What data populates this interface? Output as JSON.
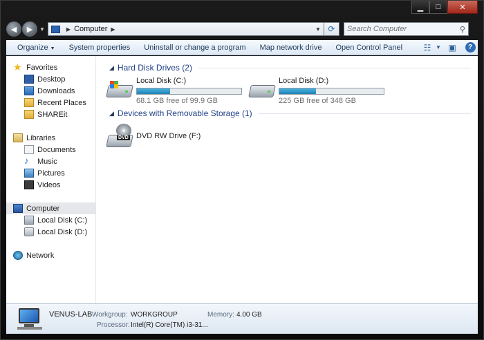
{
  "window": {
    "minimize_glyph": "▁",
    "maximize_glyph": "□",
    "close_glyph": "✕"
  },
  "address": {
    "crumb": "Computer",
    "search_placeholder": "Search Computer"
  },
  "toolbar": {
    "items": [
      {
        "label": "Organize",
        "has_caret": true
      },
      {
        "label": "System properties"
      },
      {
        "label": "Uninstall or change a program"
      },
      {
        "label": "Map network drive"
      },
      {
        "label": "Open Control Panel"
      }
    ],
    "help_glyph": "?"
  },
  "sidebar": {
    "favorites": {
      "label": "Favorites",
      "items": [
        {
          "label": "Desktop",
          "icon": "desktop-icon"
        },
        {
          "label": "Downloads",
          "icon": "downloads-icon"
        },
        {
          "label": "Recent Places",
          "icon": "recent-places-icon"
        },
        {
          "label": "SHAREit",
          "icon": "folder-icon"
        }
      ]
    },
    "libraries": {
      "label": "Libraries",
      "items": [
        {
          "label": "Documents",
          "icon": "documents-icon"
        },
        {
          "label": "Music",
          "icon": "music-icon"
        },
        {
          "label": "Pictures",
          "icon": "pictures-icon"
        },
        {
          "label": "Videos",
          "icon": "videos-icon"
        }
      ]
    },
    "computer": {
      "label": "Computer",
      "items": [
        {
          "label": "Local Disk (C:)",
          "icon": "system-drive-icon"
        },
        {
          "label": "Local Disk (D:)",
          "icon": "drive-icon"
        }
      ]
    },
    "network": {
      "label": "Network"
    }
  },
  "main": {
    "hard_disk_group": "Hard Disk Drives (2)",
    "removable_group": "Devices with Removable Storage (1)",
    "drives": [
      {
        "name": "Local Disk (C:)",
        "free_text": "68.1 GB free of 99.9 GB",
        "used_fraction": 0.32
      },
      {
        "name": "Local Disk (D:)",
        "free_text": "225 GB free of 348 GB",
        "used_fraction": 0.35
      }
    ],
    "dvd": {
      "name": "DVD RW Drive (F:)",
      "badge": "DVD"
    }
  },
  "details": {
    "computer_name": "VENUS-LAB",
    "workgroup_label": "Workgroup:",
    "workgroup_value": "WORKGROUP",
    "memory_label": "Memory:",
    "memory_value": "4.00 GB",
    "processor_label": "Processor:",
    "processor_value": "Intel(R) Core(TM) i3-31..."
  },
  "colors": {
    "accent": "#1e3f86",
    "bar_fill": "#1c82b6"
  }
}
